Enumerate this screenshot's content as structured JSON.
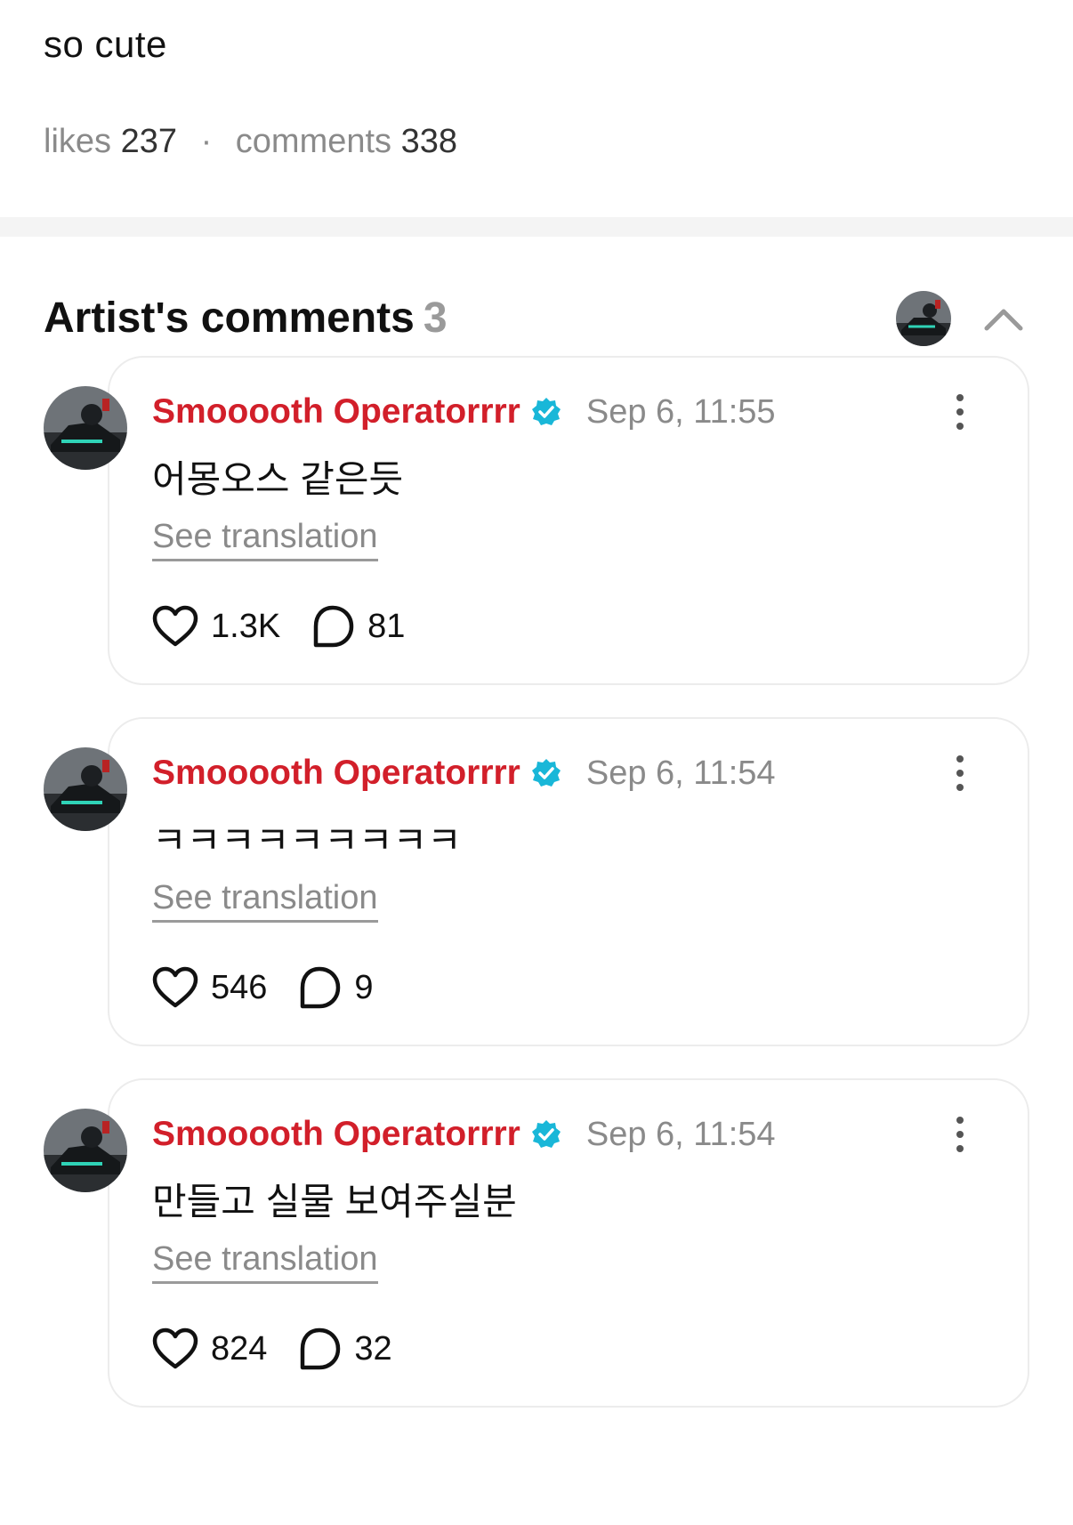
{
  "post": {
    "text": "so cute",
    "likes_label": "likes",
    "likes_count": "237",
    "separator": "·",
    "comments_label": "comments",
    "comments_count": "338"
  },
  "artist_comments": {
    "title": "Artist's comments",
    "count": "3",
    "collapse_icon": "chevron-up-icon"
  },
  "comments": [
    {
      "author": "Smooooth Operatorrrr",
      "verified_icon": "verified-badge-icon",
      "time": "Sep 6, 11:55",
      "body": "어몽오스 같은듯",
      "translation_label": "See translation",
      "likes": "1.3K",
      "replies": "81"
    },
    {
      "author": "Smooooth Operatorrrr",
      "verified_icon": "verified-badge-icon",
      "time": "Sep 6, 11:54",
      "body": "ㅋㅋㅋㅋㅋㅋㅋㅋㅋ",
      "translation_label": "See translation",
      "likes": "546",
      "replies": "9"
    },
    {
      "author": "Smooooth Operatorrrr",
      "verified_icon": "verified-badge-icon",
      "time": "Sep 6, 11:54",
      "body": "만들고 실물 보여주실분",
      "translation_label": "See translation",
      "likes": "824",
      "replies": "32"
    }
  ],
  "colors": {
    "author": "#d21f2a",
    "verified": "#19b7d8",
    "muted": "#8a8a8a"
  }
}
